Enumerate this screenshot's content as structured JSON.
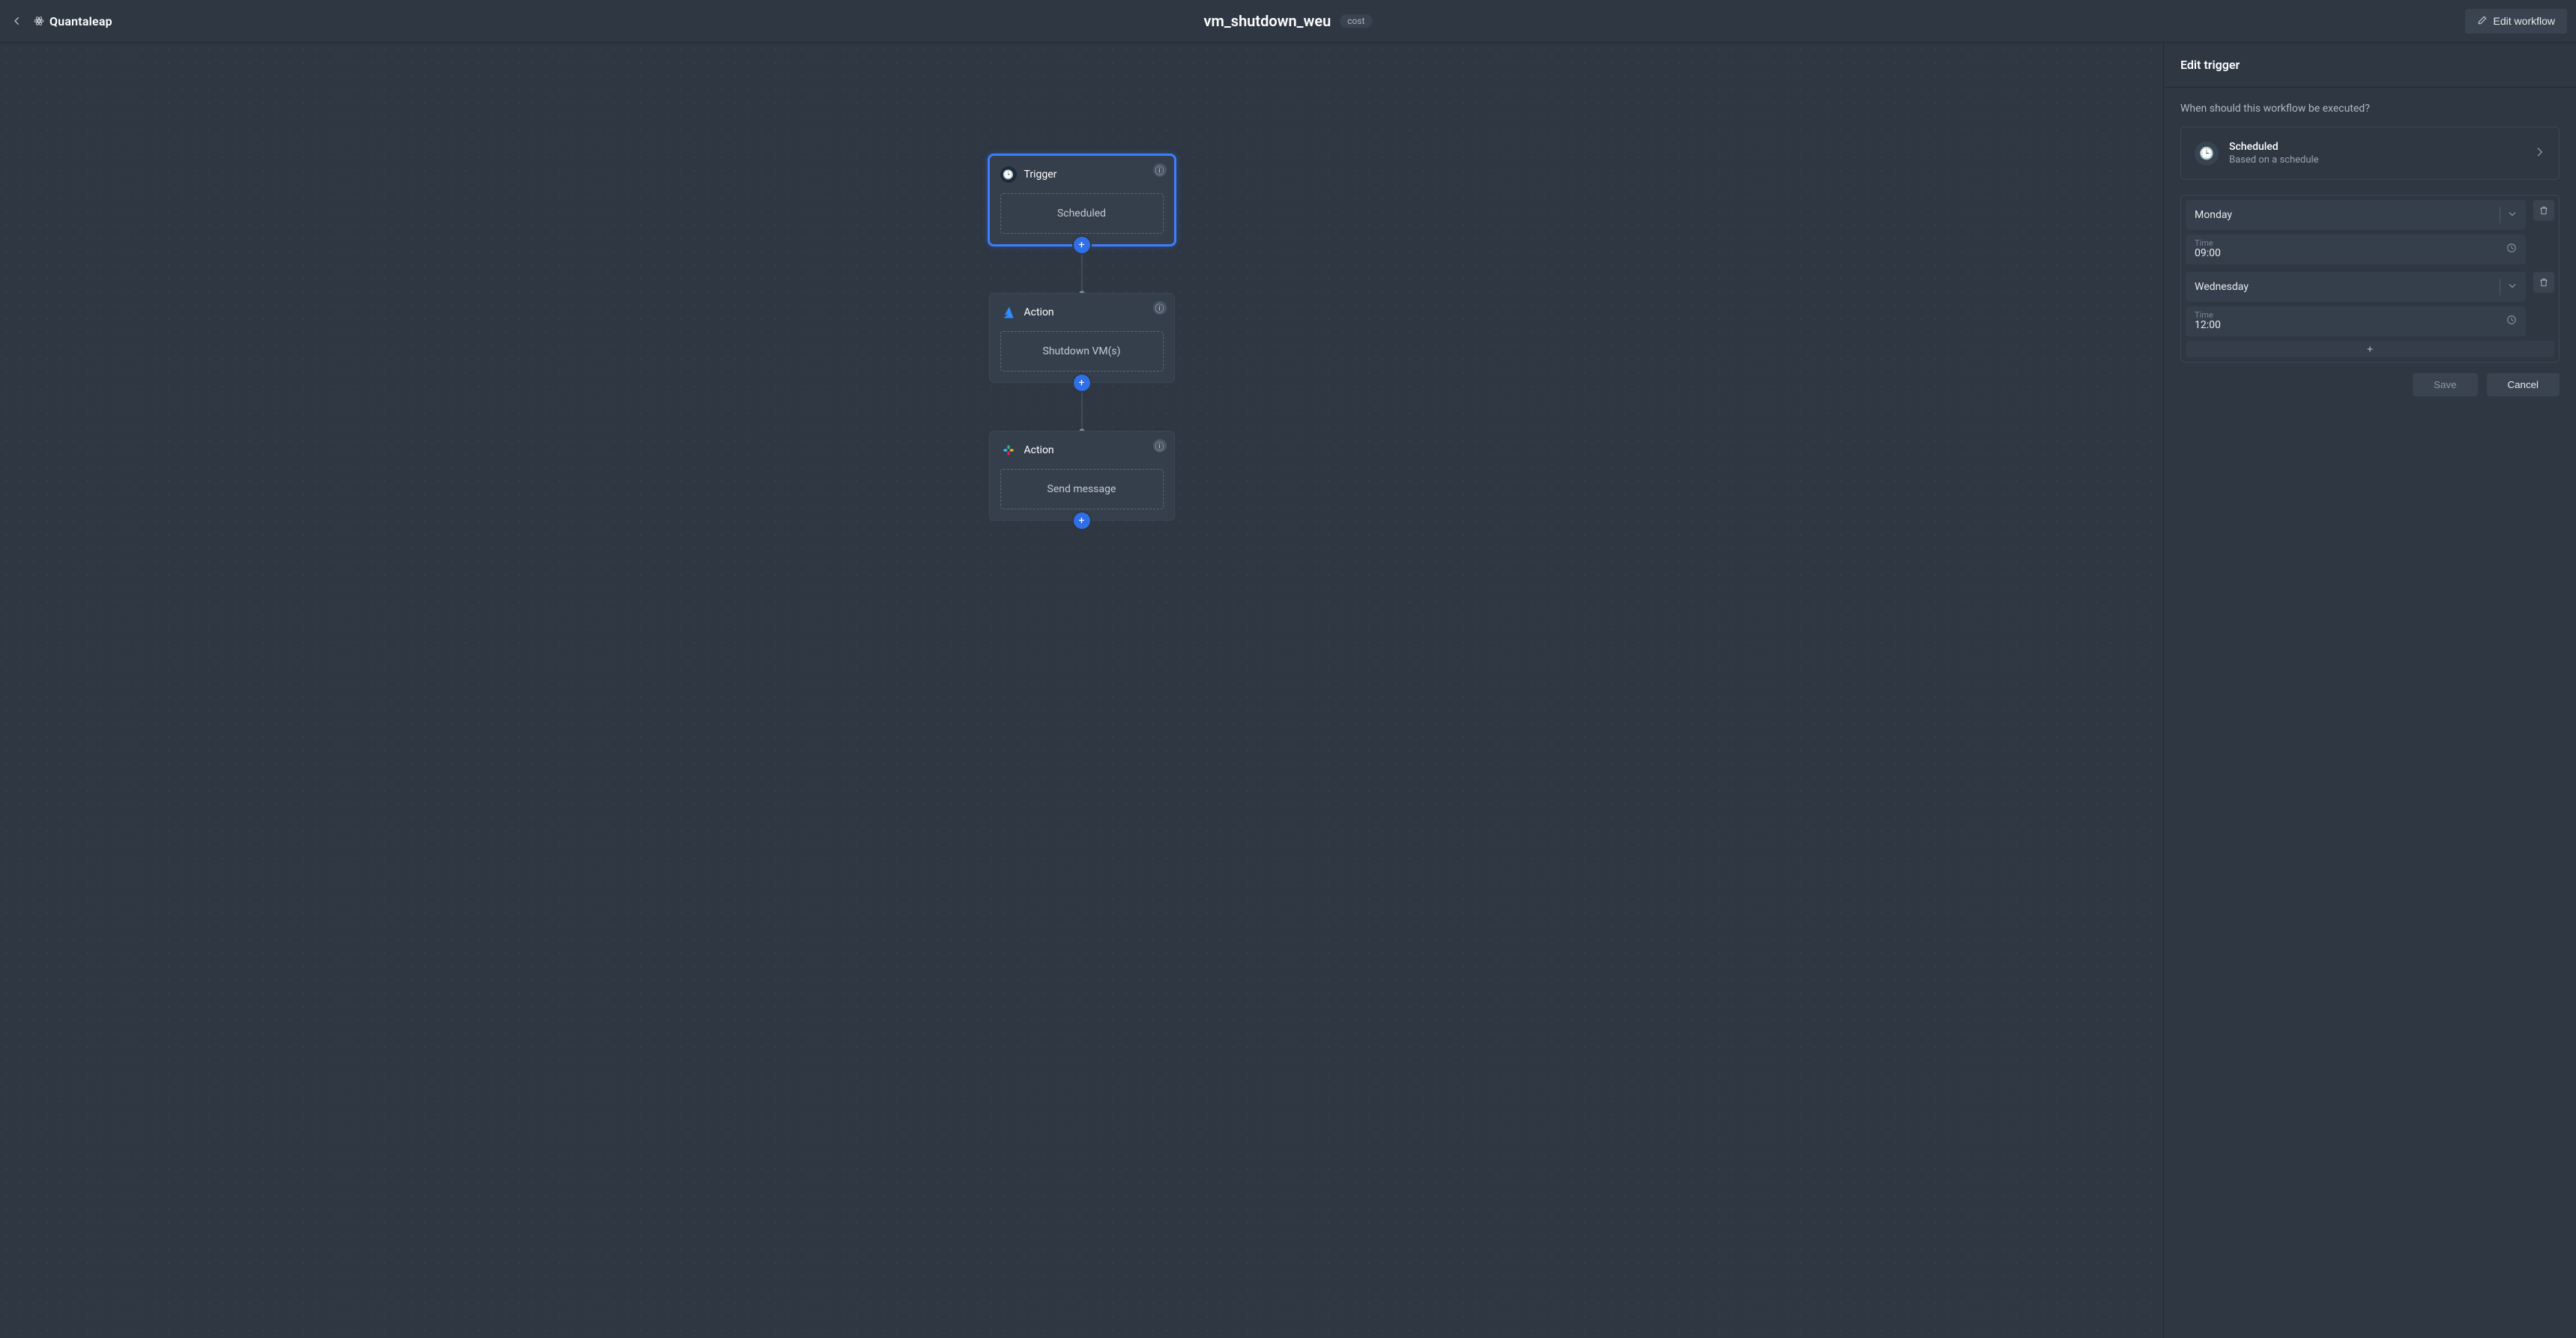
{
  "brand": {
    "name": "Quantaleap"
  },
  "header": {
    "workflow_title": "vm_shutdown_weu",
    "tag": "cost",
    "edit_button_label": "Edit workflow"
  },
  "canvas": {
    "nodes": [
      {
        "kind": "trigger",
        "title": "Trigger",
        "box_label": "Scheduled"
      },
      {
        "kind": "action",
        "title": "Action",
        "box_label": "Shutdown VM(s)",
        "provider": "azure"
      },
      {
        "kind": "action",
        "title": "Action",
        "box_label": "Send message",
        "provider": "slack"
      }
    ]
  },
  "panel": {
    "title": "Edit trigger",
    "question": "When should this workflow be executed?",
    "trigger_type": {
      "name": "Scheduled",
      "subtitle": "Based on a schedule"
    },
    "schedule": [
      {
        "day": "Monday",
        "time_label": "Time",
        "time_value": "09:00"
      },
      {
        "day": "Wednesday",
        "time_label": "Time",
        "time_value": "12:00"
      }
    ],
    "buttons": {
      "save": "Save",
      "cancel": "Cancel"
    }
  }
}
